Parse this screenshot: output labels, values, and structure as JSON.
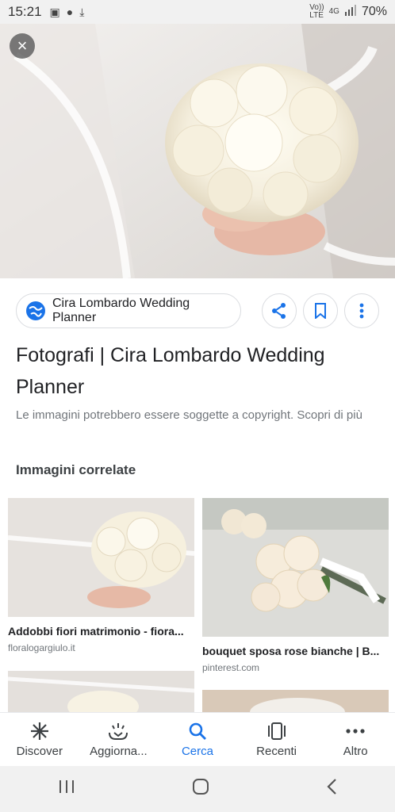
{
  "status_bar": {
    "time": "15:21",
    "network_top": "Vo))",
    "network_bottom": "LTE",
    "signal_label": "4G",
    "battery": "70%"
  },
  "hero": {
    "close_label": "×"
  },
  "source": {
    "site_name": "Cira Lombardo Wedding Planner"
  },
  "result": {
    "title": "Fotografi | Cira Lombardo Wedding Planner",
    "copyright_note": "Le immagini potrebbero essere soggette a copyright. Scopri di più"
  },
  "related": {
    "heading": "Immagini correlate",
    "items": [
      {
        "title": "Addobbi fiori matrimonio - fiora...",
        "source": "floralogargiulo.it"
      },
      {
        "title": "bouquet sposa rose bianche | B...",
        "source": "pinterest.com"
      }
    ]
  },
  "bottom_nav": [
    {
      "label": "Discover"
    },
    {
      "label": "Aggiorna..."
    },
    {
      "label": "Cerca"
    },
    {
      "label": "Recenti"
    },
    {
      "label": "Altro"
    }
  ],
  "colors": {
    "accent": "#1a73e8",
    "text": "#202124",
    "muted": "#70757a"
  }
}
